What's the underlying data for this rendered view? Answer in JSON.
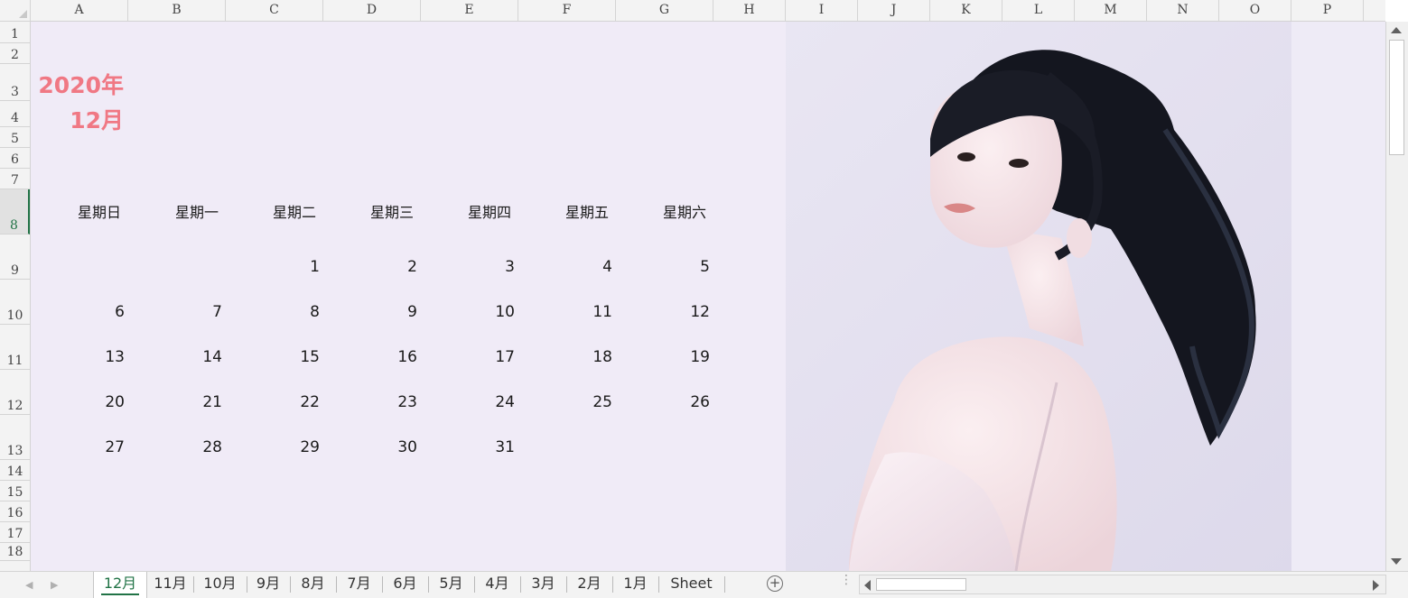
{
  "columns": [
    "A",
    "B",
    "C",
    "D",
    "E",
    "F",
    "G",
    "H",
    "I",
    "J",
    "K",
    "L",
    "M",
    "N",
    "O",
    "P"
  ],
  "rows": [
    "1",
    "2",
    "3",
    "4",
    "5",
    "6",
    "7",
    "8",
    "9",
    "10",
    "11",
    "12",
    "13",
    "14",
    "15",
    "16",
    "17",
    "18"
  ],
  "selected_row": "8",
  "calendar": {
    "year_label": "2020年",
    "month_label": "12月",
    "weekdays": [
      "星期日",
      "星期一",
      "星期二",
      "星期三",
      "星期四",
      "星期五",
      "星期六"
    ],
    "weeks": [
      [
        "",
        "",
        "1",
        "2",
        "3",
        "4",
        "5"
      ],
      [
        "6",
        "7",
        "8",
        "9",
        "10",
        "11",
        "12"
      ],
      [
        "13",
        "14",
        "15",
        "16",
        "17",
        "18",
        "19"
      ],
      [
        "20",
        "21",
        "22",
        "23",
        "24",
        "25",
        "26"
      ],
      [
        "27",
        "28",
        "29",
        "30",
        "31",
        "",
        ""
      ]
    ]
  },
  "sheet_tabs": [
    "12月",
    "11月",
    "10月",
    "9月",
    "8月",
    "7月",
    "6月",
    "5月",
    "4月",
    "3月",
    "2月",
    "1月",
    "Sheet"
  ],
  "active_tab": "12月",
  "add_sheet_symbol": "+",
  "colors": {
    "sheet_background": "#f0ebf7",
    "title": "#f07884",
    "accent": "#217346"
  },
  "image": "portrait-photo"
}
